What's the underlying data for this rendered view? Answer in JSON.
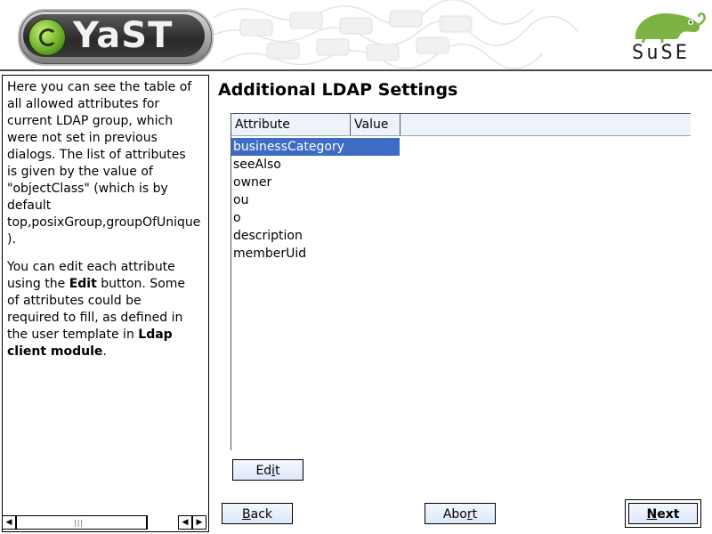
{
  "header": {
    "app_logo_text": "YaST",
    "vendor_logo_text": "SuSE"
  },
  "help": {
    "paragraph1": [
      "Here you can see the table of",
      "all allowed attributes for",
      "current LDAP group, which",
      "were not set in previous",
      "dialogs. The list of attributes",
      "is given by the value of",
      "\"objectClass\" (which is by",
      "default",
      "top,posixGroup,groupOfUnique",
      ")."
    ],
    "p2_line1": "You can edit each attribute",
    "p2_line2_a": "using the ",
    "p2_line2_b": "Edit",
    "p2_line2_c": " button. Some",
    "p2_line3": "of attributes could be",
    "p2_line4": "required to fill, as defined in",
    "p2_line5_a": "the user template in ",
    "p2_line5_b": "Ldap",
    "p2_line6_a": "client module",
    "p2_line6_b": "."
  },
  "main": {
    "title": "Additional LDAP Settings",
    "table": {
      "columns": [
        "Attribute",
        "Value"
      ],
      "rows": [
        {
          "attribute": "businessCategory",
          "value": "",
          "selected": true
        },
        {
          "attribute": "seeAlso",
          "value": ""
        },
        {
          "attribute": "owner",
          "value": ""
        },
        {
          "attribute": "ou",
          "value": ""
        },
        {
          "attribute": "o",
          "value": ""
        },
        {
          "attribute": "description",
          "value": ""
        },
        {
          "attribute": "memberUid",
          "value": ""
        }
      ]
    }
  },
  "buttons": {
    "edit": {
      "pre": "Ed",
      "accel": "i",
      "post": "t"
    },
    "back": {
      "pre": "",
      "accel": "B",
      "post": "ack"
    },
    "abort": {
      "pre": "Abo",
      "accel": "r",
      "post": "t"
    },
    "next": {
      "pre": "",
      "accel": "N",
      "post": "ext"
    }
  },
  "colors": {
    "selection": "#3d6cc4",
    "button_bg": "#dde8fa",
    "header_bg": "#eef3fb"
  },
  "icons": {
    "scroll_left": "triangle-left",
    "scroll_right": "triangle-right"
  }
}
